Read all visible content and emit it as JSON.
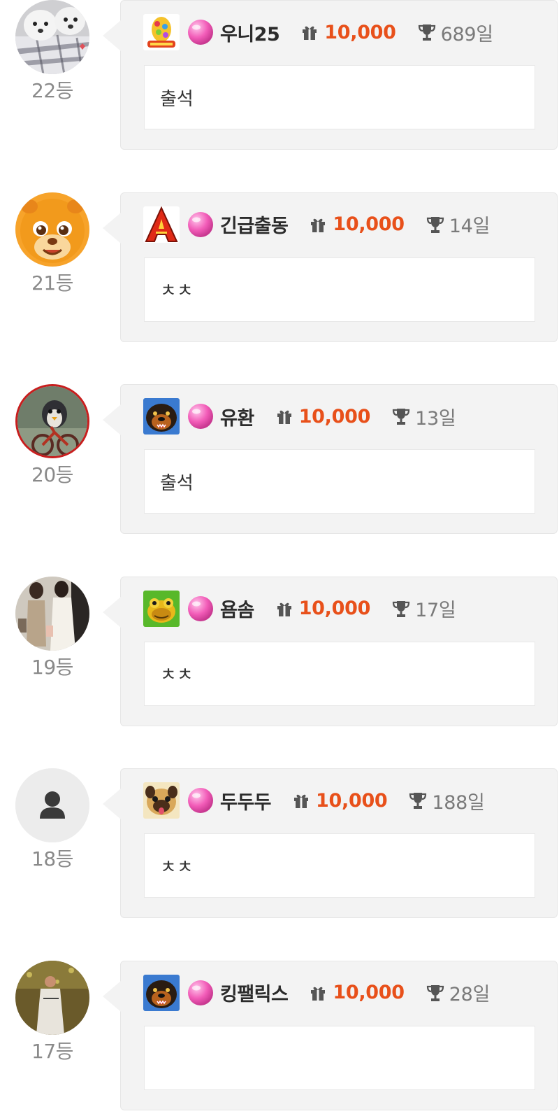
{
  "comments": [
    {
      "rank": "22등",
      "nickname": "우니25",
      "points": "10,000",
      "days": "689일",
      "message": "출석",
      "avatar": "two-white-puppies-photo",
      "game_badge": "easter-egg-game-icon"
    },
    {
      "rank": "21등",
      "nickname": "긴급출동",
      "points": "10,000",
      "days": "14일",
      "message": "ㅊㅊ",
      "avatar": "orange-cartoon-lion-avatar",
      "game_badge": "letter-a-game-icon"
    },
    {
      "rank": "20등",
      "nickname": "유환",
      "points": "10,000",
      "days": "13일",
      "message": "출석",
      "avatar": "penguin-on-bicycle-avatar",
      "game_badge": "rottweiler-dog-game-icon"
    },
    {
      "rank": "19등",
      "nickname": "욤솜",
      "points": "10,000",
      "days": "17일",
      "message": "ㅊㅊ",
      "avatar": "people-standing-photo",
      "game_badge": "green-frog-game-icon"
    },
    {
      "rank": "18등",
      "nickname": "두두두",
      "points": "10,000",
      "days": "188일",
      "message": "ㅊㅊ",
      "avatar": "default-person-avatar",
      "game_badge": "pug-dog-game-icon"
    },
    {
      "rank": "17등",
      "nickname": "킹팰릭스",
      "points": "10,000",
      "days": "28일",
      "message": "",
      "avatar": "baseball-player-photo",
      "game_badge": "rottweiler-dog-game-icon"
    }
  ],
  "colors": {
    "points": "#e8501a",
    "card_background": "#f3f3f3",
    "rank_text": "#8a8a8a"
  },
  "icons": {
    "candy": "pink-candy-icon",
    "gift": "gift-icon",
    "trophy": "trophy-icon"
  }
}
